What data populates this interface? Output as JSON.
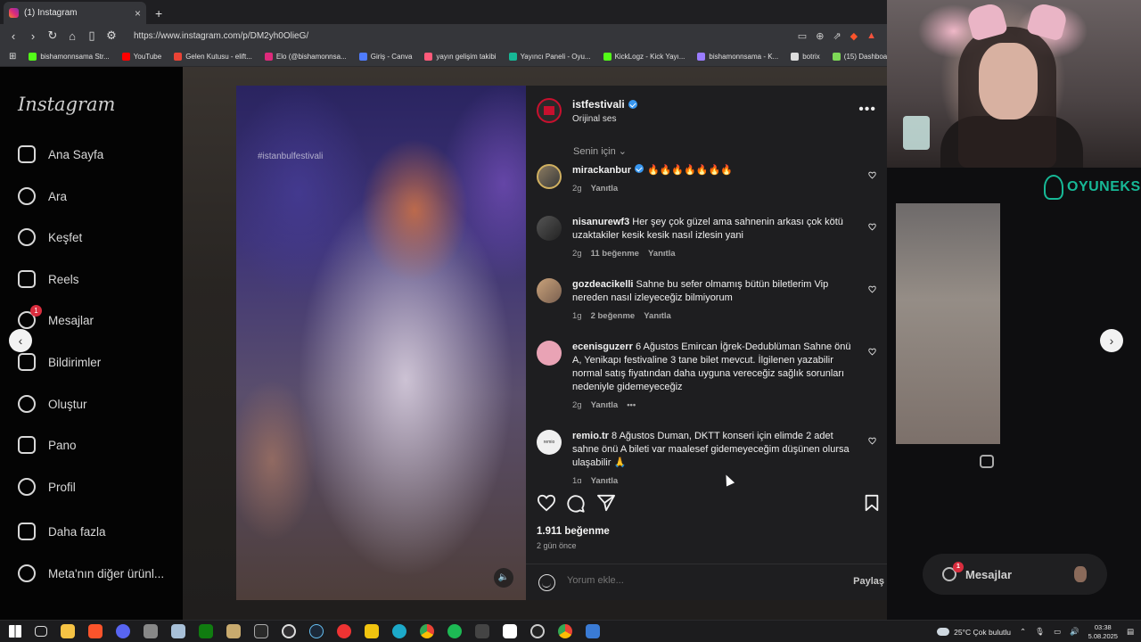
{
  "browser": {
    "tab_title": "(1) Instagram",
    "tab_close": "×",
    "new_tab": "+",
    "url": "https://www.instagram.com/p/DM2yh0OlieG/",
    "bookmarks": [
      {
        "label": "bishamonnsama Str...",
        "color": "#53fc18"
      },
      {
        "label": "YouTube",
        "color": "#ff0000"
      },
      {
        "label": "Gelen Kutusu - elift...",
        "color": "#ea4335"
      },
      {
        "label": "Elo (@bishamonnsa...",
        "color": "#dd2a7b"
      },
      {
        "label": "Giriş - Canva",
        "color": "#4f7cff"
      },
      {
        "label": "yayın gelişim takibi",
        "color": "#ff5a7a"
      },
      {
        "label": "Yayıncı Paneli - Oyu...",
        "color": "#17b896"
      },
      {
        "label": "KickLogz - Kick Yayı...",
        "color": "#53fc18"
      },
      {
        "label": "bishamonnsama - K...",
        "color": "#9a7cff"
      },
      {
        "label": "botrix",
        "color": "#dddddd"
      },
      {
        "label": "(15) Dashboard /...",
        "color": "#7ed957"
      }
    ]
  },
  "instagram": {
    "logo": "Instagram",
    "nav": [
      {
        "label": "Ana Sayfa",
        "icon": "home-icon"
      },
      {
        "label": "Ara",
        "icon": "search-icon"
      },
      {
        "label": "Keşfet",
        "icon": "compass-icon"
      },
      {
        "label": "Reels",
        "icon": "reels-icon"
      },
      {
        "label": "Mesajlar",
        "icon": "messenger-icon",
        "badge": "1"
      },
      {
        "label": "Bildirimler",
        "icon": "heart-icon"
      },
      {
        "label": "Oluştur",
        "icon": "plus-icon"
      },
      {
        "label": "Pano",
        "icon": "dashboard-icon"
      },
      {
        "label": "Profil",
        "icon": "avatar-icon"
      },
      {
        "label": "Daha fazla",
        "icon": "menu-icon"
      },
      {
        "label": "Meta'nın diğer ürünl...",
        "icon": "meta-icon"
      }
    ],
    "media_watermark": "#istanbulfestivali",
    "post": {
      "username": "istfestivali",
      "audio": "Orijinal ses",
      "for_you": "Senin için",
      "more": "•••",
      "comments": [
        {
          "user": "mirackanbur",
          "verified": true,
          "text": "🔥🔥🔥🔥🔥🔥🔥",
          "time": "2g",
          "likes": "",
          "reply": "Yanıtla"
        },
        {
          "user": "nisanurewf3",
          "verified": false,
          "text": "Her şey çok güzel ama sahnenin arkası çok kötü uzaktakiler kesik kesik nasıl izlesin yani",
          "time": "2g",
          "likes": "11 beğenme",
          "reply": "Yanıtla"
        },
        {
          "user": "gozdeacikelli",
          "verified": false,
          "text": "Sahne bu sefer olmamış bütün biletlerim Vip nereden nasıl izleyeceğiz bilmiyorum",
          "time": "1g",
          "likes": "2 beğenme",
          "reply": "Yanıtla"
        },
        {
          "user": "ecenisguzerr",
          "verified": false,
          "text": "6 Ağustos Emircan İğrek-Dedublüman Sahne önü A, Yenikapı festivaline 3 tane bilet mevcut. İlgilenen yazabilir normal satış fiyatından daha uyguna vereceğiz sağlık sorunları nedeniyle gidemeyeceğiz",
          "time": "2g",
          "likes": "",
          "reply": "Yanıtla",
          "more": "•••"
        },
        {
          "user": "remio.tr",
          "verified": false,
          "text": "8 Ağustos Duman, DKTT konseri için elimde 2 adet sahne önü A bileti var maalesef gidemeyeceğim düşünen olursa ulaşabilir 🙏",
          "time": "1g",
          "likes": "",
          "reply": "Yanıtla"
        }
      ],
      "likes": "1.911 beğenme",
      "ago": "2 gün önce",
      "comment_placeholder": "Yorum ekle...",
      "share": "Paylaş"
    }
  },
  "stream": {
    "brand": "OYUNEKS",
    "messages_pill": "Mesajlar",
    "messages_badge": "1"
  },
  "taskbar": {
    "weather": "25°C  Çok bulutlu",
    "time": "03:38",
    "date": "5.08.2025"
  }
}
